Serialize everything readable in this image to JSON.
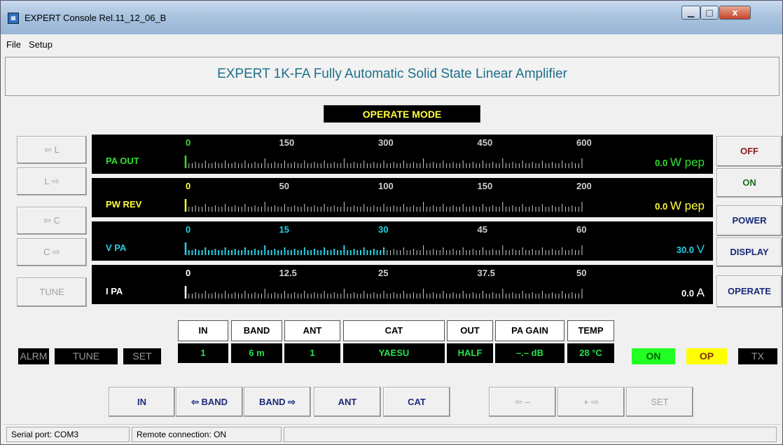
{
  "window": {
    "title": "EXPERT Console Rel.11_12_06_B",
    "min_glyph": "▁",
    "max_glyph": "□",
    "close_glyph": "x"
  },
  "menu": {
    "file": "File",
    "setup": "Setup"
  },
  "main_title": "EXPERT 1K-FA Fully Automatic Solid State Linear Amplifier",
  "mode": "OPERATE MODE",
  "left_buttons": {
    "l_left": "⇦ L",
    "l_right": "L ⇨",
    "c_left": "⇦ C",
    "c_right": "C ⇨",
    "tune": "TUNE"
  },
  "right_buttons": {
    "off": "OFF",
    "on": "ON",
    "power": "POWER",
    "display": "DISPLAY",
    "operate": "OPERATE"
  },
  "meters": [
    {
      "label": "PA OUT",
      "ticks": [
        "0",
        "150",
        "300",
        "450",
        "600"
      ],
      "value": "0.0",
      "unit": "W pep",
      "fraction": 0.0,
      "color": "#2ee12e",
      "bar_color": "#2ee12e"
    },
    {
      "label": "PW REV",
      "ticks": [
        "0",
        "50",
        "100",
        "150",
        "200"
      ],
      "value": "0.0",
      "unit": "W pep",
      "fraction": 0.0,
      "color": "#ffff3c",
      "bar_color": "#ffff3c"
    },
    {
      "label": "V PA",
      "ticks": [
        "0",
        "15",
        "30",
        "45",
        "60"
      ],
      "value": "30.0",
      "unit": "V",
      "fraction": 0.5,
      "color": "#22d3e6",
      "bar_color": "#22d3e6"
    },
    {
      "label": "I PA",
      "ticks": [
        "0",
        "12.5",
        "25",
        "37.5",
        "50"
      ],
      "value": "0.0",
      "unit": "A",
      "fraction": 0.0,
      "color": "#ffffff",
      "bar_color": "#ffffff"
    }
  ],
  "status_grid": {
    "headers": [
      "IN",
      "BAND",
      "ANT",
      "CAT",
      "OUT",
      "PA GAIN",
      "TEMP"
    ],
    "values": [
      "1",
      "6 m",
      "1",
      "YAESU",
      "HALF",
      "–.– dB",
      "28 °C"
    ]
  },
  "indicators": {
    "alrm": "ALRM",
    "tune": "TUNE",
    "set": "SET",
    "on": "ON",
    "op": "OP",
    "tx": "TX",
    "on_color": "#22ff22",
    "op_color": "#ffff00"
  },
  "bottom_buttons": {
    "in": "IN",
    "band_down": "⇦ BAND",
    "band_up": "BAND ⇨",
    "ant": "ANT",
    "cat": "CAT",
    "minus": "⇦ –",
    "plus": "+ ⇨",
    "set": "SET"
  },
  "status": {
    "serial": "Serial port: COM3",
    "remote": "Remote connection: ON"
  }
}
